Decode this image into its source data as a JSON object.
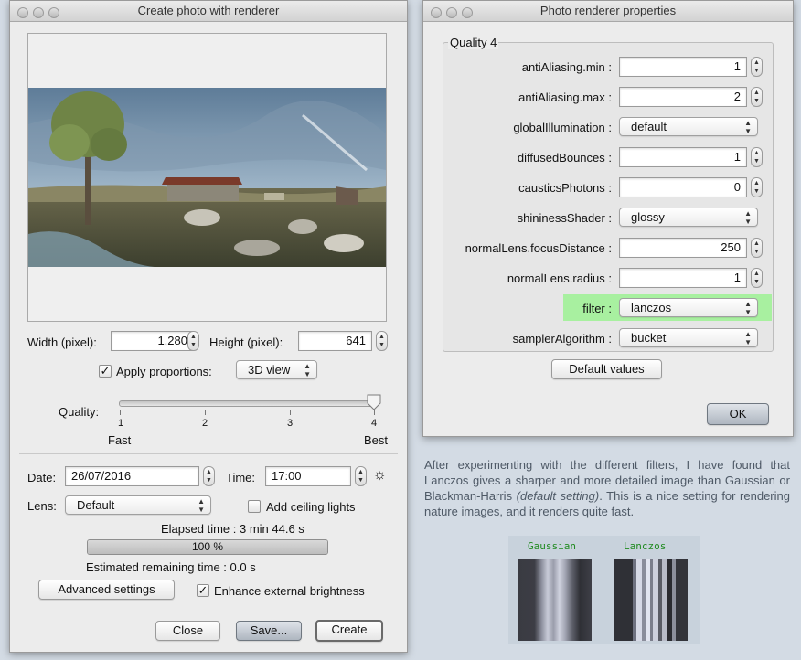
{
  "left_window": {
    "title": "Create photo with renderer",
    "width_label": "Width (pixel):",
    "width_value": "1,280",
    "height_label": "Height (pixel):",
    "height_value": "641",
    "apply_proportions_label": "Apply proportions:",
    "apply_proportions_checked": true,
    "proportions_option": "3D view",
    "quality_label": "Quality:",
    "quality_ticks": [
      "1",
      "2",
      "3",
      "4"
    ],
    "quality_value": 4,
    "quality_max": 4,
    "fast_label": "Fast",
    "best_label": "Best",
    "date_label": "Date:",
    "date_value": "26/07/2016",
    "time_label": "Time:",
    "time_value": "17:00",
    "lens_label": "Lens:",
    "lens_value": "Default",
    "ceiling_lights_label": "Add ceiling lights",
    "ceiling_lights_checked": false,
    "elapsed_text": "Elapsed time : 3 min 44.6 s",
    "progress_text": "100 %",
    "progress_fraction": 1.0,
    "remaining_text": "Estimated remaining time : 0.0 s",
    "advanced_button": "Advanced settings",
    "enhance_label": "Enhance external brightness",
    "enhance_checked": true,
    "close_button": "Close",
    "save_button": "Save...",
    "create_button": "Create"
  },
  "right_window": {
    "title": "Photo renderer properties",
    "group_title": "Quality 4",
    "properties": [
      {
        "label": "antiAliasing.min :",
        "kind": "number",
        "value": "1"
      },
      {
        "label": "antiAliasing.max :",
        "kind": "number",
        "value": "2"
      },
      {
        "label": "globalIllumination :",
        "kind": "select",
        "value": "default"
      },
      {
        "label": "diffusedBounces :",
        "kind": "number",
        "value": "1"
      },
      {
        "label": "causticsPhotons :",
        "kind": "number",
        "value": "0"
      },
      {
        "label": "shininessShader :",
        "kind": "select",
        "value": "glossy"
      },
      {
        "label": "normalLens.focusDistance :",
        "kind": "number",
        "value": "250"
      },
      {
        "label": "normalLens.radius :",
        "kind": "number",
        "value": "1"
      },
      {
        "label": "filter :",
        "kind": "select",
        "value": "lanczos",
        "highlighted": true
      },
      {
        "label": "samplerAlgorithm :",
        "kind": "select",
        "value": "bucket"
      }
    ],
    "default_values_button": "Default values",
    "ok_button": "OK"
  },
  "caption": {
    "text_before": "After experimenting with the different filters, I have found that Lanczos gives a sharper and more detailed image than Gaussian or Blackman-Harris ",
    "text_italic": "(default setting)",
    "text_after": ". This is a nice setting for rendering nature images, and it renders quite fast."
  },
  "comparison": {
    "gaussian_label": "Gaussian",
    "lanczos_label": "Lanczos",
    "label_color": "#1f8a1f",
    "highlight_color": "#a8f0a0"
  }
}
